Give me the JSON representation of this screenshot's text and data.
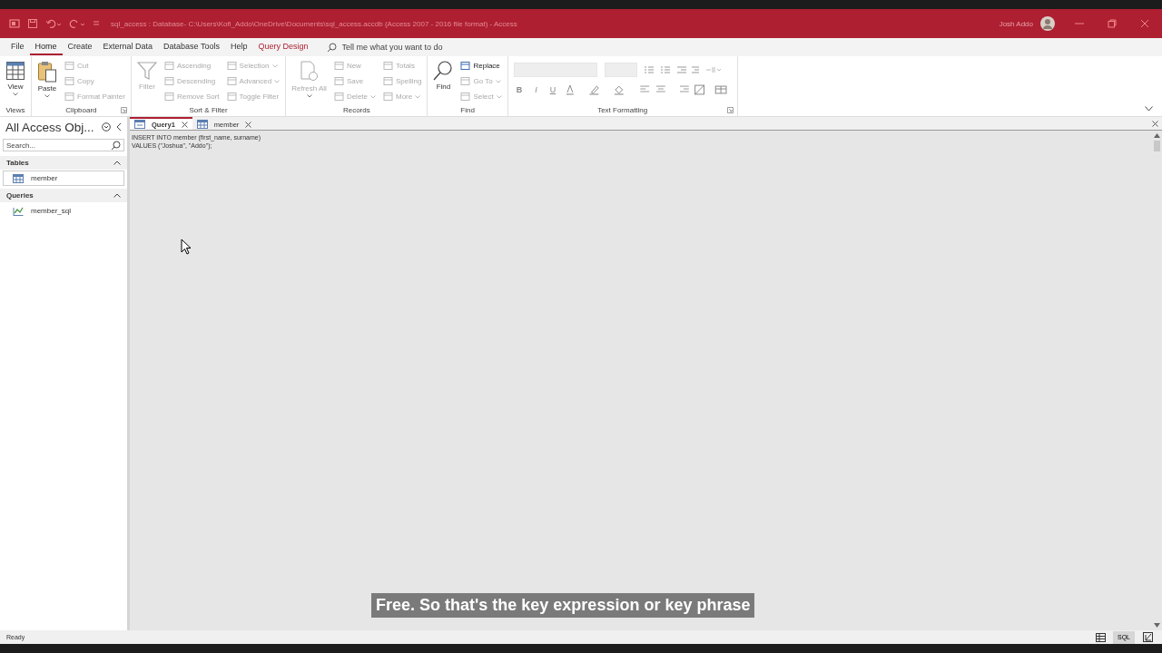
{
  "title_bar": {
    "title": "sql_access : Database- C:\\Users\\Kofi_Addo\\OneDrive\\Documents\\sql_access.accdb (Access 2007 - 2016 file format)  -  Access",
    "user": "Josh Addo"
  },
  "menu_tabs": [
    {
      "label": "File",
      "selected": false,
      "kind": "plain"
    },
    {
      "label": "Home",
      "selected": true,
      "kind": "plain"
    },
    {
      "label": "Create",
      "selected": false,
      "kind": "plain"
    },
    {
      "label": "External Data",
      "selected": false,
      "kind": "plain"
    },
    {
      "label": "Database Tools",
      "selected": false,
      "kind": "plain"
    },
    {
      "label": "Help",
      "selected": false,
      "kind": "plain"
    },
    {
      "label": "Query Design",
      "selected": false,
      "kind": "contextual"
    }
  ],
  "tell_me": {
    "placeholder": "Tell me what you want to do"
  },
  "ribbon": {
    "groups": [
      {
        "label": "Views",
        "launcher": false,
        "items": [
          {
            "kind": "large",
            "label": "View",
            "disabled": false,
            "dropdown": true
          }
        ]
      },
      {
        "label": "Clipboard",
        "launcher": true,
        "items": [
          {
            "kind": "large",
            "label": "Paste",
            "disabled": false,
            "dropdown": true
          },
          {
            "kind": "column",
            "buttons": [
              {
                "label": "Cut",
                "disabled": true,
                "dropdown": false
              },
              {
                "label": "Copy",
                "disabled": true,
                "dropdown": false
              },
              {
                "label": "Format Painter",
                "disabled": true,
                "dropdown": false
              }
            ]
          }
        ]
      },
      {
        "label": "Sort & Filter",
        "launcher": false,
        "items": [
          {
            "kind": "large",
            "label": "Filter",
            "disabled": true,
            "dropdown": false
          },
          {
            "kind": "column",
            "buttons": [
              {
                "label": "Ascending",
                "disabled": true,
                "dropdown": false
              },
              {
                "label": "Descending",
                "disabled": true,
                "dropdown": false
              },
              {
                "label": "Remove Sort",
                "disabled": true,
                "dropdown": false
              }
            ]
          },
          {
            "kind": "column",
            "buttons": [
              {
                "label": "Selection",
                "disabled": true,
                "dropdown": true
              },
              {
                "label": "Advanced",
                "disabled": true,
                "dropdown": true
              },
              {
                "label": "Toggle Filter",
                "disabled": true,
                "dropdown": false
              }
            ]
          }
        ]
      },
      {
        "label": "Records",
        "launcher": false,
        "items": [
          {
            "kind": "large",
            "label": "Refresh All",
            "disabled": true,
            "dropdown": true
          },
          {
            "kind": "column",
            "buttons": [
              {
                "label": "New",
                "disabled": true,
                "dropdown": false
              },
              {
                "label": "Save",
                "disabled": true,
                "dropdown": false
              },
              {
                "label": "Delete",
                "disabled": true,
                "dropdown": true
              }
            ]
          },
          {
            "kind": "column",
            "buttons": [
              {
                "label": "Totals",
                "disabled": true,
                "dropdown": false
              },
              {
                "label": "Spelling",
                "disabled": true,
                "dropdown": false
              },
              {
                "label": "More",
                "disabled": true,
                "dropdown": true
              }
            ]
          }
        ]
      },
      {
        "label": "Find",
        "launcher": false,
        "items": [
          {
            "kind": "large",
            "label": "Find",
            "disabled": false,
            "dropdown": false
          },
          {
            "kind": "column",
            "buttons": [
              {
                "label": "Replace",
                "disabled": false,
                "dropdown": false
              },
              {
                "label": "Go To",
                "disabled": true,
                "dropdown": true
              },
              {
                "label": "Select",
                "disabled": true,
                "dropdown": true
              }
            ]
          }
        ]
      },
      {
        "label": "Text Formatting",
        "launcher": true,
        "items": [
          {
            "kind": "formatting",
            "buttons": [
              "B",
              "I",
              "U"
            ]
          }
        ]
      }
    ]
  },
  "nav_pane": {
    "title": "All Access Obj...",
    "search": {
      "placeholder": "Search..."
    },
    "sections": [
      {
        "label": "Tables",
        "expanded": true,
        "items": [
          {
            "label": "member",
            "kind": "table",
            "selected": true
          }
        ]
      },
      {
        "label": "Queries",
        "expanded": true,
        "items": [
          {
            "label": "member_sql",
            "kind": "query",
            "selected": false
          }
        ]
      }
    ]
  },
  "doc_tabs": [
    {
      "label": "Query1",
      "kind": "query",
      "selected": true
    },
    {
      "label": "member",
      "kind": "table",
      "selected": false
    }
  ],
  "sql_lines": [
    "INSERT INTO member (first_name, surname)",
    "VALUES (\"Joshua\", \"Addo\");"
  ],
  "caption": "Free. So that's the key expression or key phrase",
  "status_bar": {
    "text": "Ready",
    "views": [
      {
        "kind": "datasheet",
        "selected": false
      },
      {
        "kind": "sql",
        "label": "SQL",
        "selected": true
      },
      {
        "kind": "design",
        "selected": false
      }
    ]
  }
}
